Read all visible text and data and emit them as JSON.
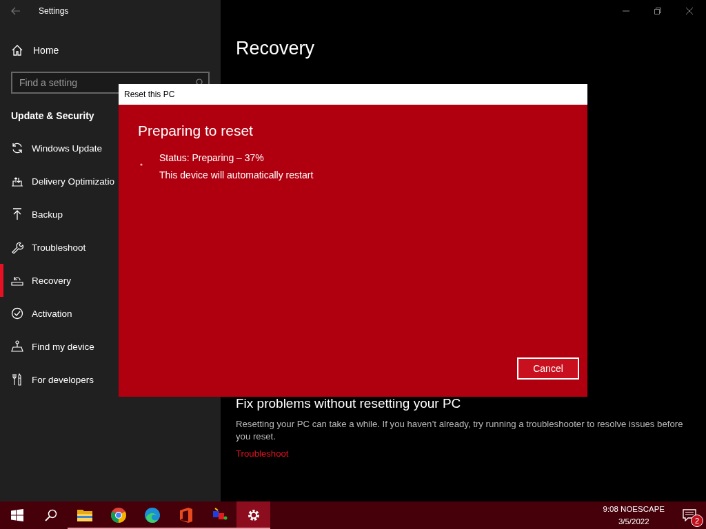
{
  "window": {
    "title": "Settings"
  },
  "sidebar": {
    "home": "Home",
    "search": {
      "placeholder": "Find a setting"
    },
    "section": "Update & Security",
    "items": [
      {
        "label": "Windows Update",
        "kind": "update",
        "selected": false
      },
      {
        "label": "Delivery Optimizatio",
        "kind": "delivery",
        "selected": false
      },
      {
        "label": "Backup",
        "kind": "backup",
        "selected": false
      },
      {
        "label": "Troubleshoot",
        "kind": "wrench",
        "selected": false
      },
      {
        "label": "Recovery",
        "kind": "recovery",
        "selected": true
      },
      {
        "label": "Activation",
        "kind": "activation",
        "selected": false
      },
      {
        "label": "Find my device",
        "kind": "find",
        "selected": false
      },
      {
        "label": "For developers",
        "kind": "developers",
        "selected": false
      }
    ]
  },
  "main": {
    "title": "Recovery",
    "fix_heading": "Fix problems without resetting your PC",
    "fix_text": "Resetting your PC can take a while. If you haven’t already, try running a troubleshooter to resolve issues before you reset.",
    "fix_link": "Troubleshoot"
  },
  "dialog": {
    "title": "Reset this PC",
    "heading": "Preparing to reset",
    "status": "Status: Preparing – 37%",
    "note": "This device will automatically restart",
    "button": "Cancel"
  },
  "taskbar": {
    "apps": [
      {
        "kind": "start",
        "running": false,
        "active": false
      },
      {
        "kind": "search",
        "running": false,
        "active": false
      },
      {
        "kind": "explorer",
        "running": true,
        "active": false
      },
      {
        "kind": "chrome",
        "running": true,
        "active": false
      },
      {
        "kind": "edge",
        "running": true,
        "active": false
      },
      {
        "kind": "office",
        "running": true,
        "active": false
      },
      {
        "kind": "paint",
        "running": true,
        "active": false
      },
      {
        "kind": "settings",
        "running": true,
        "active": true
      }
    ],
    "time": "9:08 NOESCAPE",
    "date": "3/5/2022",
    "notifications": "2"
  }
}
